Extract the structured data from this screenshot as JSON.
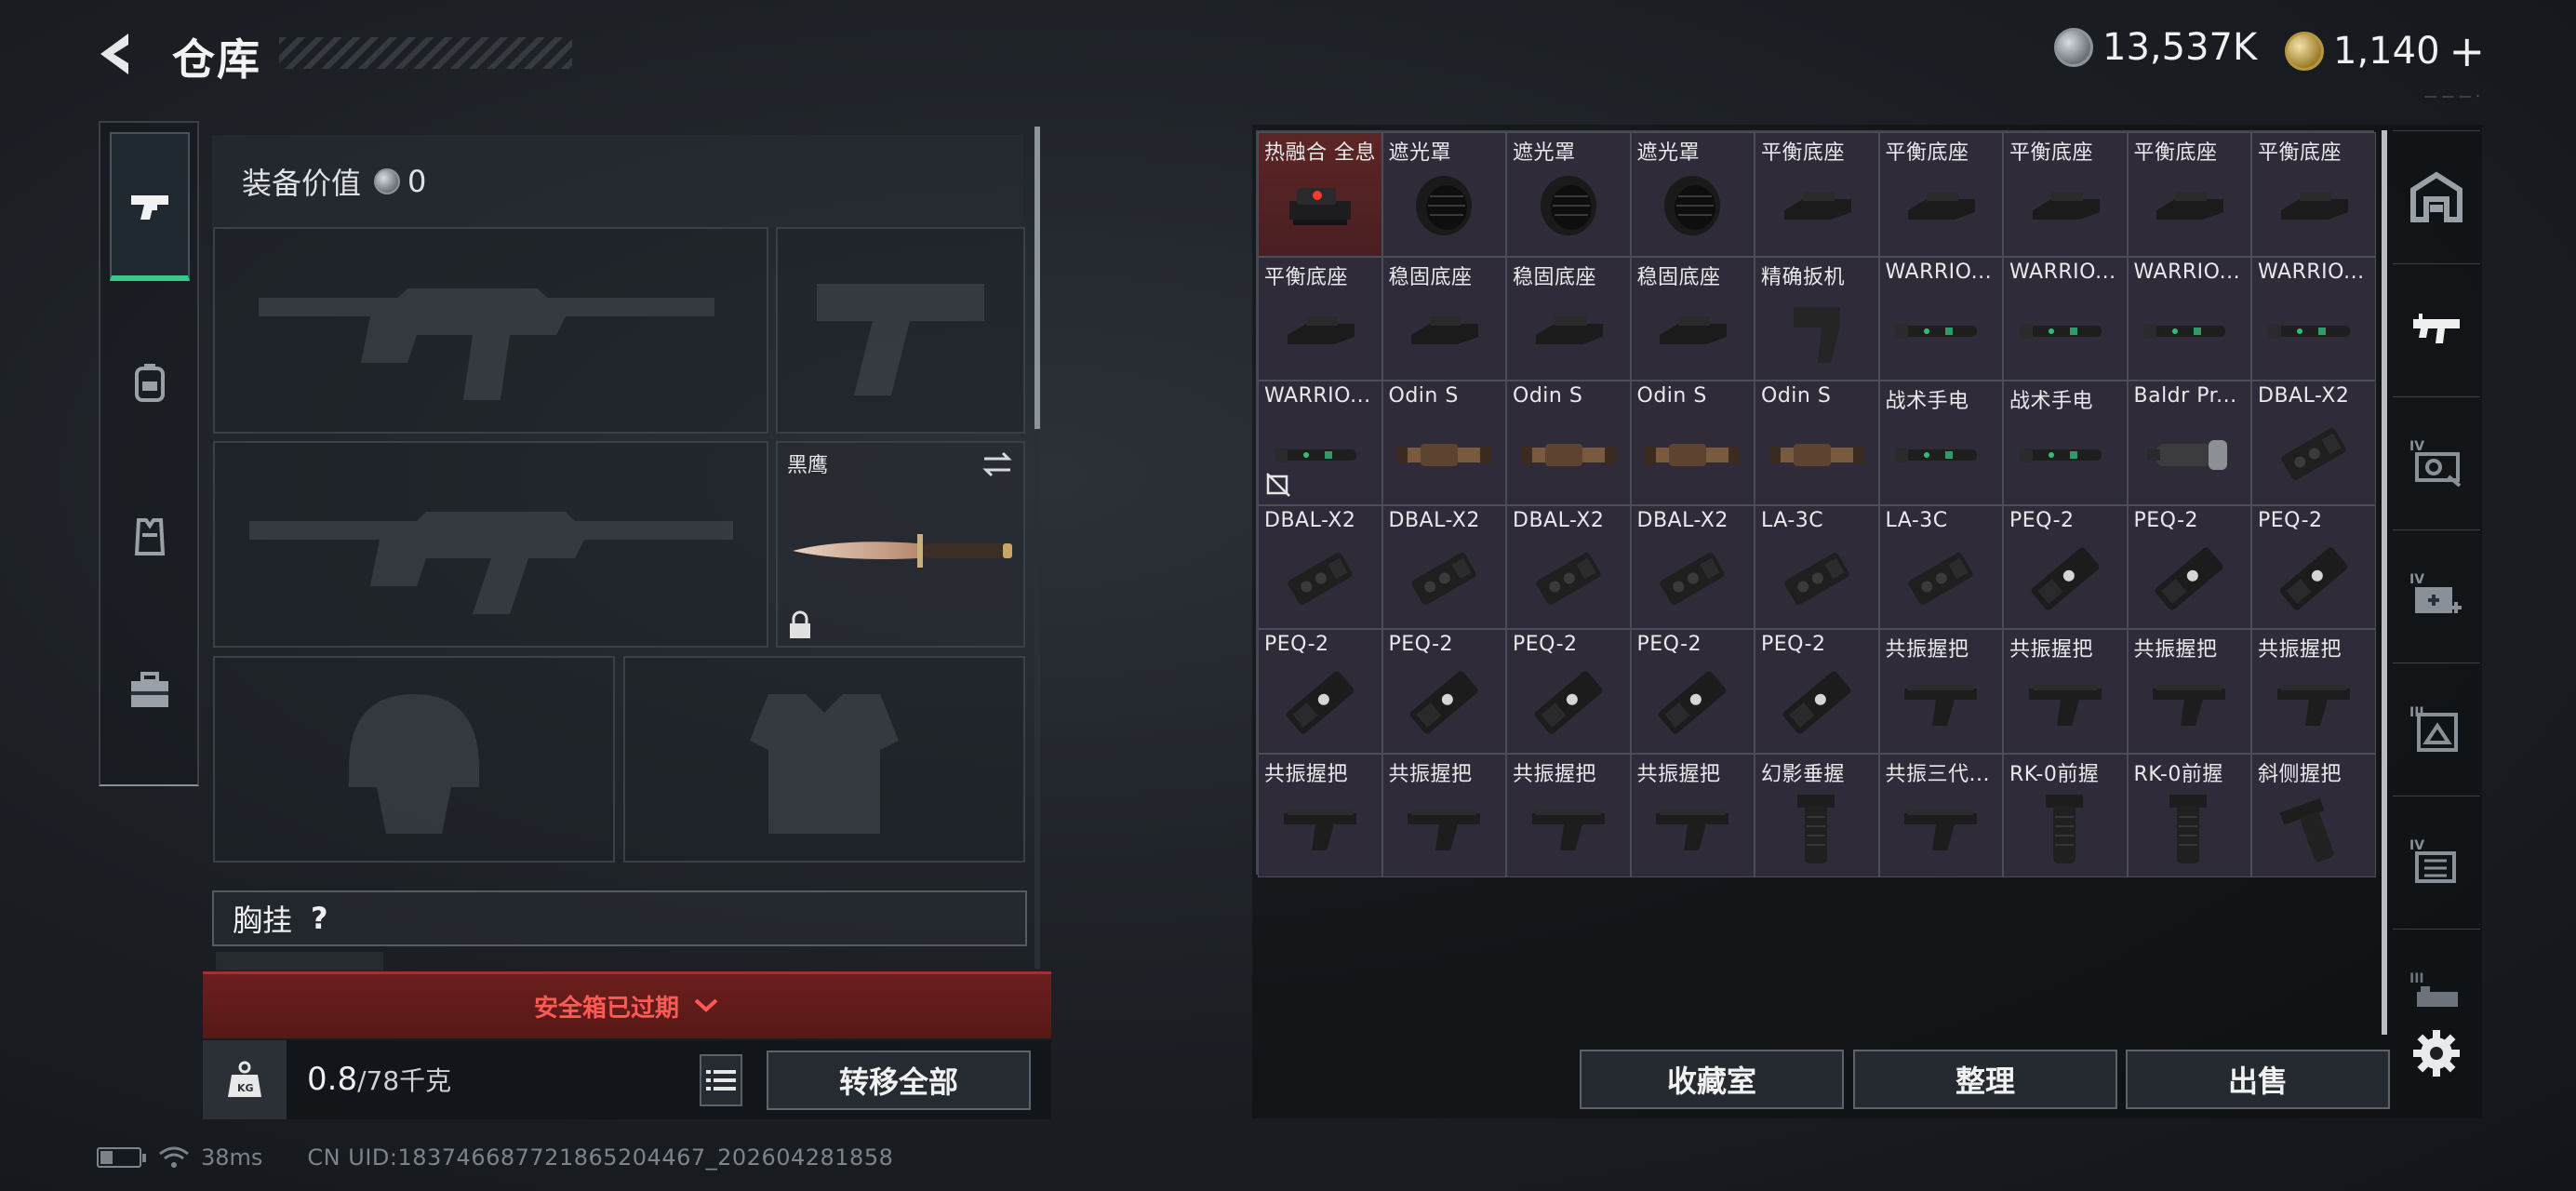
{
  "header": {
    "title": "仓库",
    "currency_silver": "13,537K",
    "currency_gold": "1,140",
    "gold_plus": "+",
    "version_tag": "— — — ·"
  },
  "equipment": {
    "value_label": "装备价值",
    "value_amount": "0",
    "melee_label": "黑鹰",
    "chest_label": "胸挂",
    "chest_hint": "?",
    "safe_box_status": "安全箱已过期",
    "weight_current": "0.8",
    "weight_capacity": "/78千克",
    "transfer_all": "转移全部"
  },
  "inventory": {
    "items": [
      {
        "name": "热融合 全息",
        "type": "sight",
        "highlight": true
      },
      {
        "name": "遮光罩",
        "type": "hood"
      },
      {
        "name": "遮光罩",
        "type": "hood"
      },
      {
        "name": "遮光罩",
        "type": "hood"
      },
      {
        "name": "平衡底座",
        "type": "base"
      },
      {
        "name": "平衡底座",
        "type": "base"
      },
      {
        "name": "平衡底座",
        "type": "base"
      },
      {
        "name": "平衡底座",
        "type": "base"
      },
      {
        "name": "平衡底座",
        "type": "base"
      },
      {
        "name": "平衡底座",
        "type": "base"
      },
      {
        "name": "稳固底座",
        "type": "base"
      },
      {
        "name": "稳固底座",
        "type": "base"
      },
      {
        "name": "稳固底座",
        "type": "base"
      },
      {
        "name": "精确扳机",
        "type": "trigger"
      },
      {
        "name": "WARRIO...",
        "type": "flashlight"
      },
      {
        "name": "WARRIO...",
        "type": "flashlight"
      },
      {
        "name": "WARRIO...",
        "type": "flashlight"
      },
      {
        "name": "WARRIO...",
        "type": "flashlight"
      },
      {
        "name": "WARRIO...",
        "type": "flashlight",
        "unmodifiable": true
      },
      {
        "name": "Odin S",
        "type": "scope"
      },
      {
        "name": "Odin S",
        "type": "scope"
      },
      {
        "name": "Odin S",
        "type": "scope"
      },
      {
        "name": "Odin S",
        "type": "scope"
      },
      {
        "name": "战术手电",
        "type": "flashlight"
      },
      {
        "name": "战术手电",
        "type": "flashlight"
      },
      {
        "name": "Baldr Pr...",
        "type": "light"
      },
      {
        "name": "DBAL-X2",
        "type": "laser"
      },
      {
        "name": "DBAL-X2",
        "type": "laser"
      },
      {
        "name": "DBAL-X2",
        "type": "laser"
      },
      {
        "name": "DBAL-X2",
        "type": "laser"
      },
      {
        "name": "DBAL-X2",
        "type": "laser"
      },
      {
        "name": "LA-3C",
        "type": "laser"
      },
      {
        "name": "LA-3C",
        "type": "laser"
      },
      {
        "name": "PEQ-2",
        "type": "peq"
      },
      {
        "name": "PEQ-2",
        "type": "peq"
      },
      {
        "name": "PEQ-2",
        "type": "peq"
      },
      {
        "name": "PEQ-2",
        "type": "peq"
      },
      {
        "name": "PEQ-2",
        "type": "peq"
      },
      {
        "name": "PEQ-2",
        "type": "peq"
      },
      {
        "name": "PEQ-2",
        "type": "peq"
      },
      {
        "name": "PEQ-2",
        "type": "peq"
      },
      {
        "name": "共振握把",
        "type": "grip"
      },
      {
        "name": "共振握把",
        "type": "grip"
      },
      {
        "name": "共振握把",
        "type": "grip"
      },
      {
        "name": "共振握把",
        "type": "grip"
      },
      {
        "name": "共振握把",
        "type": "grip"
      },
      {
        "name": "共振握把",
        "type": "grip"
      },
      {
        "name": "共振握把",
        "type": "grip"
      },
      {
        "name": "共振握把",
        "type": "grip"
      },
      {
        "name": "幻影垂握",
        "type": "vgrip"
      },
      {
        "name": "共振三代...",
        "type": "grip"
      },
      {
        "name": "RK-0前握",
        "type": "vgrip"
      },
      {
        "name": "RK-0前握",
        "type": "vgrip"
      },
      {
        "name": "斜侧握把",
        "type": "angled"
      }
    ],
    "buttons": {
      "collection": "收藏室",
      "organize": "整理",
      "sell": "出售"
    }
  },
  "status_bar": {
    "ping": "38ms",
    "uid": "CN UID:18374668772186520446​7_202604281858"
  }
}
